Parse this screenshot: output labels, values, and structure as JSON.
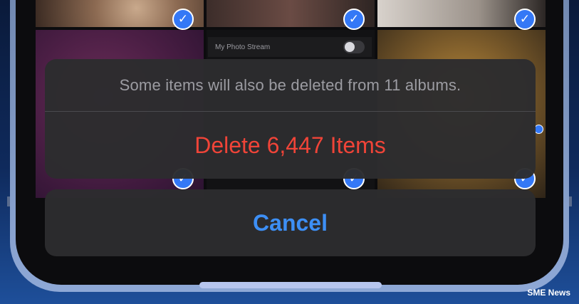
{
  "photos": {
    "stream_label": "My Photo Stream",
    "check_glyph": "✓"
  },
  "action_sheet": {
    "message": "Some items will also be deleted from 11 albums.",
    "delete_label": "Delete 6,447 Items",
    "cancel_label": "Cancel"
  },
  "watermark": "SME News",
  "colors": {
    "destructive": "#f04438",
    "cancel": "#3d8ff5",
    "check": "#3478f6"
  }
}
